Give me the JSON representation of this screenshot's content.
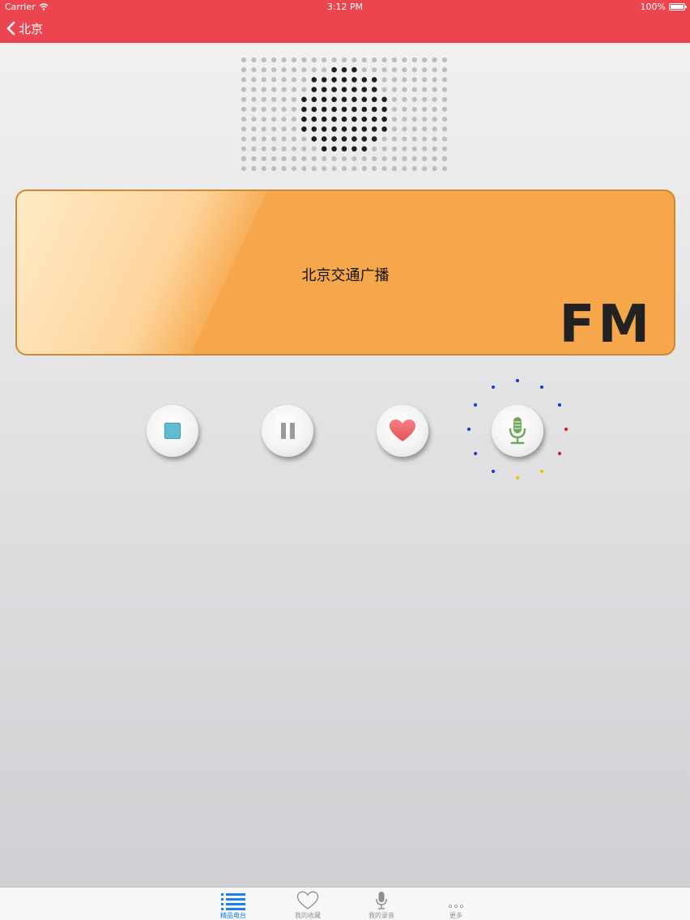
{
  "status_bar": {
    "carrier": "Carrier",
    "time": "3:12 PM",
    "battery": "100%"
  },
  "nav": {
    "back_label": "北京"
  },
  "display": {
    "station": "北京交通广播",
    "band": "FM"
  },
  "controls": {
    "stop_icon": "stop-icon",
    "pause_icon": "pause-icon",
    "favorite_icon": "heart-icon",
    "record_icon": "microphone-icon"
  },
  "tabbar": {
    "items": [
      {
        "label": "精品电台",
        "icon": "list-icon",
        "active": true
      },
      {
        "label": "我的收藏",
        "icon": "heart-outline-icon",
        "active": false
      },
      {
        "label": "我的录音",
        "icon": "microphone-icon",
        "active": false
      },
      {
        "label": "更多",
        "icon": "more-icon",
        "active": false
      }
    ]
  },
  "colors": {
    "nav_bar": "#eb4650",
    "display_panel": "#f6a74c",
    "active_tab": "#1a7ff0"
  }
}
